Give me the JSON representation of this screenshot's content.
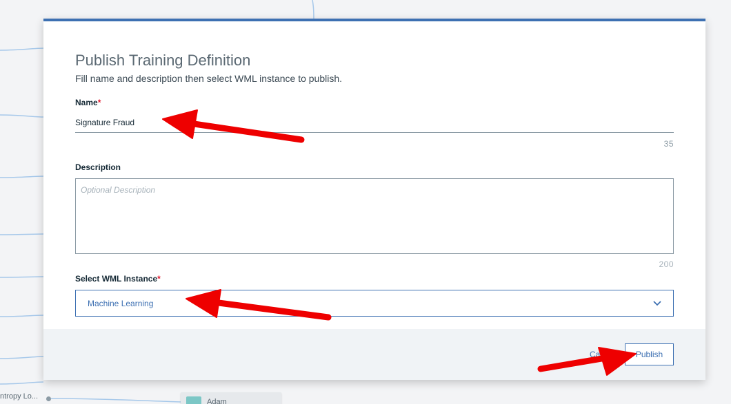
{
  "background": {
    "node_left_label": "ntropy Lo...",
    "node_adam_label": "Adam"
  },
  "modal": {
    "title": "Publish Training Definition",
    "subtitle": "Fill name and description then select WML instance to publish.",
    "name_field": {
      "label": "Name",
      "required_mark": "*",
      "value": "Signature Fraud",
      "remaining_chars": "35"
    },
    "description_field": {
      "label": "Description",
      "placeholder": "Optional Description",
      "value": "",
      "remaining_chars": "200"
    },
    "wml_field": {
      "label": "Select WML Instance",
      "required_mark": "*",
      "selected": "Machine Learning",
      "icon": "chevron-down-icon"
    },
    "footer": {
      "cancel_label": "Cancel",
      "publish_label": "Publish"
    }
  },
  "colors": {
    "accent": "#3d70b2",
    "required": "#e0182d",
    "annotation_arrow": "#ee0000"
  }
}
